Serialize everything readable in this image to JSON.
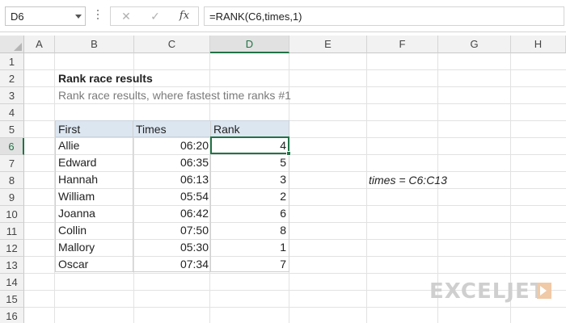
{
  "formula_bar": {
    "name_box": "D6",
    "cancel_icon": "close-icon",
    "enter_icon": "check-icon",
    "fx_label": "fx",
    "formula": "=RANK(C6,times,1)"
  },
  "columns": [
    "A",
    "B",
    "C",
    "D",
    "E",
    "F",
    "G",
    "H"
  ],
  "rows": [
    "1",
    "2",
    "3",
    "4",
    "5",
    "6",
    "7",
    "8",
    "9",
    "10",
    "11",
    "12",
    "13",
    "14",
    "15",
    "16"
  ],
  "active_cell": {
    "column": "D",
    "row": "6"
  },
  "sheet": {
    "title": "Rank race results",
    "subtitle": "Rank race results, where fastest time ranks #1",
    "headers": {
      "first": "First",
      "times": "Times",
      "rank": "Rank"
    },
    "records": [
      {
        "first": "Allie",
        "time": "06:20",
        "rank": "4"
      },
      {
        "first": "Edward",
        "time": "06:35",
        "rank": "5"
      },
      {
        "first": "Hannah",
        "time": "06:13",
        "rank": "3"
      },
      {
        "first": "William",
        "time": "05:54",
        "rank": "2"
      },
      {
        "first": "Joanna",
        "time": "06:42",
        "rank": "6"
      },
      {
        "first": "Collin",
        "time": "07:50",
        "rank": "8"
      },
      {
        "first": "Mallory",
        "time": "05:30",
        "rank": "1"
      },
      {
        "first": "Oscar",
        "time": "07:34",
        "rank": "7"
      }
    ],
    "named_range_note": "times = C6:C13"
  },
  "logo": {
    "text": "EXCELJET"
  },
  "colors": {
    "accent": "#217346",
    "table_header": "#dce6f1"
  }
}
